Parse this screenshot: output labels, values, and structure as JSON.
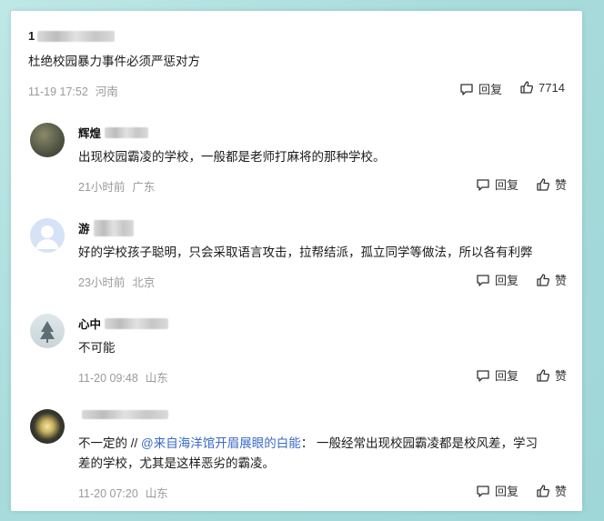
{
  "top_comment": {
    "author_visible": "1",
    "text": "杜绝校园暴力事件必须严惩对方",
    "time": "11-19 17:52",
    "location": "河南",
    "reply_label": "回复",
    "like_count": "7714"
  },
  "replies": [
    {
      "author_visible": "辉煌",
      "text": "出现校园霸凌的学校，一般都是老师打麻将的那种学校。",
      "time": "21小时前",
      "location": "广东",
      "reply_label": "回复",
      "like_label": "赞"
    },
    {
      "author_visible": "游",
      "text": "好的学校孩子聪明，只会采取语言攻击，拉帮结派，孤立同学等做法，所以各有利弊",
      "time": "23小时前",
      "location": "北京",
      "reply_label": "回复",
      "like_label": "赞"
    },
    {
      "author_visible": "心中",
      "text": "不可能",
      "time": "11-20 09:48",
      "location": "山东",
      "reply_label": "回复",
      "like_label": "赞"
    },
    {
      "author_visible": "",
      "text_prefix": "不一定的 //",
      "mention": "@来自海洋馆开眉展眼的白能",
      "text_suffix_line1": "： 一般经常出现校园霸凌都是校风差，学习",
      "text_line2": "差的学校，尤其是这样恶劣的霸凌。",
      "time": "11-20 07:20",
      "location": "山东",
      "reply_label": "回复",
      "like_label": "赞"
    }
  ],
  "colors": {
    "background": "#a9dcdc",
    "mention": "#3a6ac7",
    "meta": "#9a9a9a"
  }
}
